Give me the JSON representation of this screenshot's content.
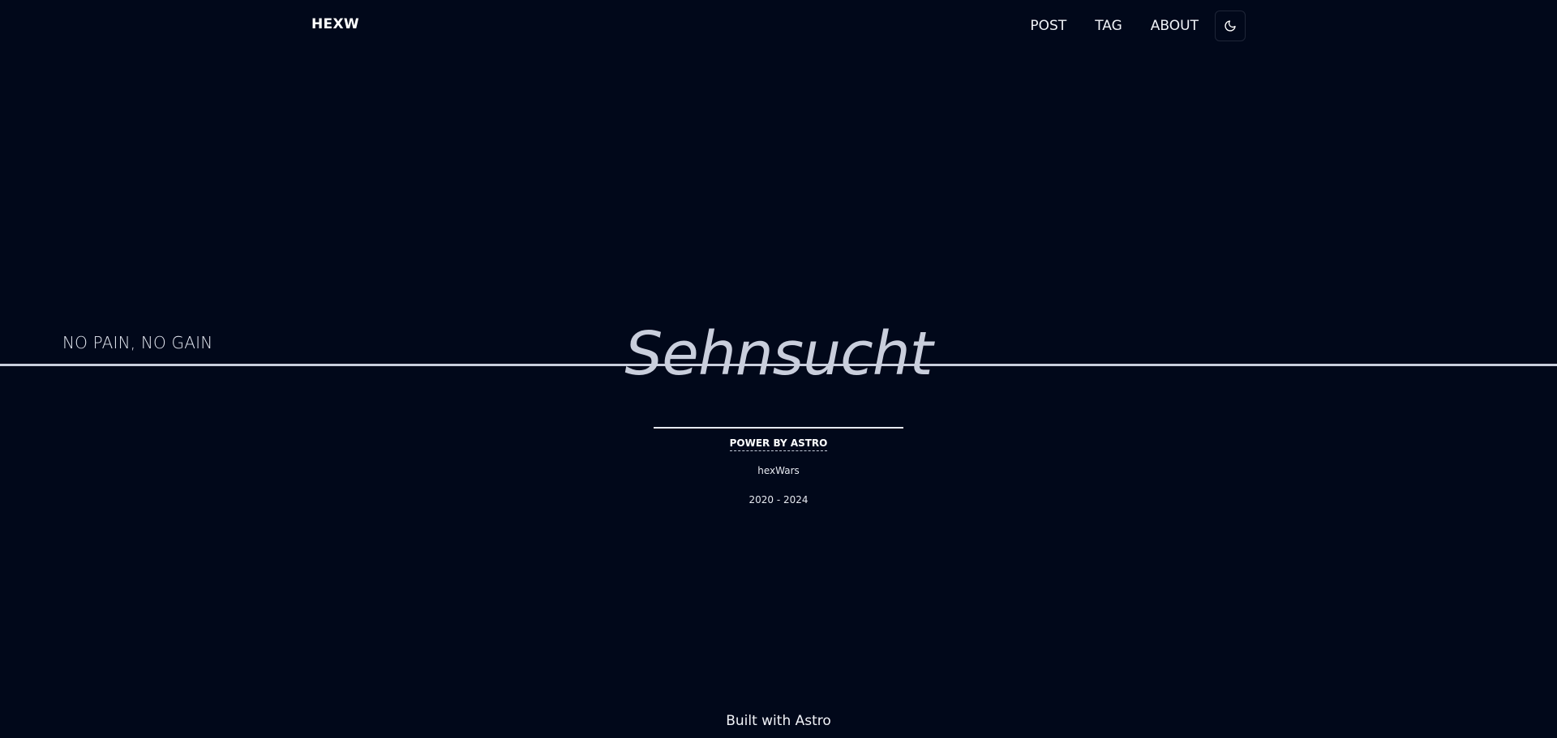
{
  "header": {
    "brand": "HEXW",
    "nav": {
      "post": "POST",
      "tag": "TAG",
      "about": "ABOUT"
    },
    "theme_toggle_icon": "moon-icon"
  },
  "hero": {
    "tagline": "NO PAIN, NO GAIN",
    "title": "Sehnsucht",
    "power_link": "POWER BY ASTRO",
    "author": "hexWars",
    "years": "2020 - 2024"
  },
  "footer": {
    "text": "Built with Astro"
  },
  "colors": {
    "background": "#01081a",
    "title": "#c9cedc",
    "text": "#ffffff"
  }
}
